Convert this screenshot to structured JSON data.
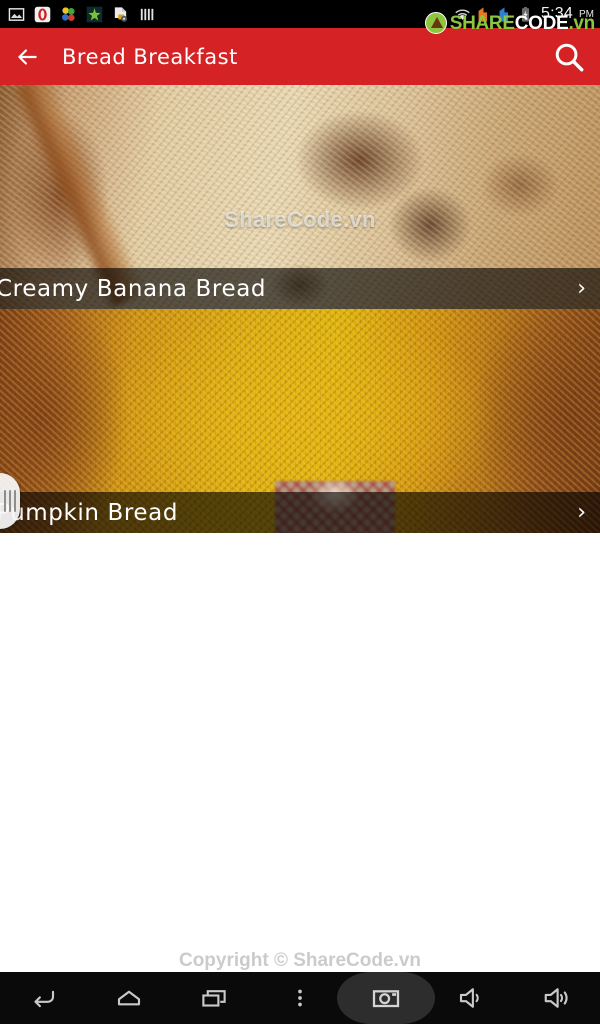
{
  "status_bar": {
    "time": "5:34",
    "ampm": "PM",
    "left_icons": [
      {
        "name": "image-icon",
        "label": "Image"
      },
      {
        "name": "opera-icon",
        "label": "Opera"
      },
      {
        "name": "colors-app-icon",
        "label": "Colors"
      },
      {
        "name": "green-star-icon",
        "label": "Star"
      },
      {
        "name": "secure-file-icon",
        "label": "Secure File"
      },
      {
        "name": "bars-icon",
        "label": "Bars"
      }
    ],
    "right_icons": [
      {
        "name": "wifi-icon",
        "label": "Wi-Fi"
      },
      {
        "name": "signal-orange-icon",
        "label": "Signal 1"
      },
      {
        "name": "signal-blue-icon",
        "label": "Signal 2"
      },
      {
        "name": "battery-charging-icon",
        "label": "Battery Charging"
      }
    ]
  },
  "watermark": {
    "brand_share": "SHARE",
    "brand_code": "CODE",
    "brand_vn": ".vn",
    "image_text": "ShareCode.vn",
    "footer_text": "Copyright © ShareCode.vn"
  },
  "appbar": {
    "back_label": "Back",
    "title": "Bread Breakfast",
    "search_label": "Search",
    "background_color": "#d42225",
    "text_color": "#ffffff"
  },
  "list": {
    "items": [
      {
        "title": "Creamy Banana Bread",
        "chevron": "›",
        "image_name": "banana-bread-photo"
      },
      {
        "title": "Pumpkin Bread",
        "chevron": "›",
        "image_name": "pumpkin-bread-photo"
      }
    ]
  },
  "drawer_grip": {
    "label": "Drawer handle"
  },
  "navbar": {
    "buttons": [
      {
        "name": "nav-back-button",
        "label": "Back"
      },
      {
        "name": "nav-home-button",
        "label": "Home"
      },
      {
        "name": "nav-recents-button",
        "label": "Recent apps"
      },
      {
        "name": "nav-menu-button",
        "label": "Menu"
      },
      {
        "name": "nav-screenshot-button",
        "label": "Screenshot"
      },
      {
        "name": "nav-volume-down-button",
        "label": "Volume down"
      },
      {
        "name": "nav-volume-up-button",
        "label": "Volume up"
      }
    ]
  }
}
